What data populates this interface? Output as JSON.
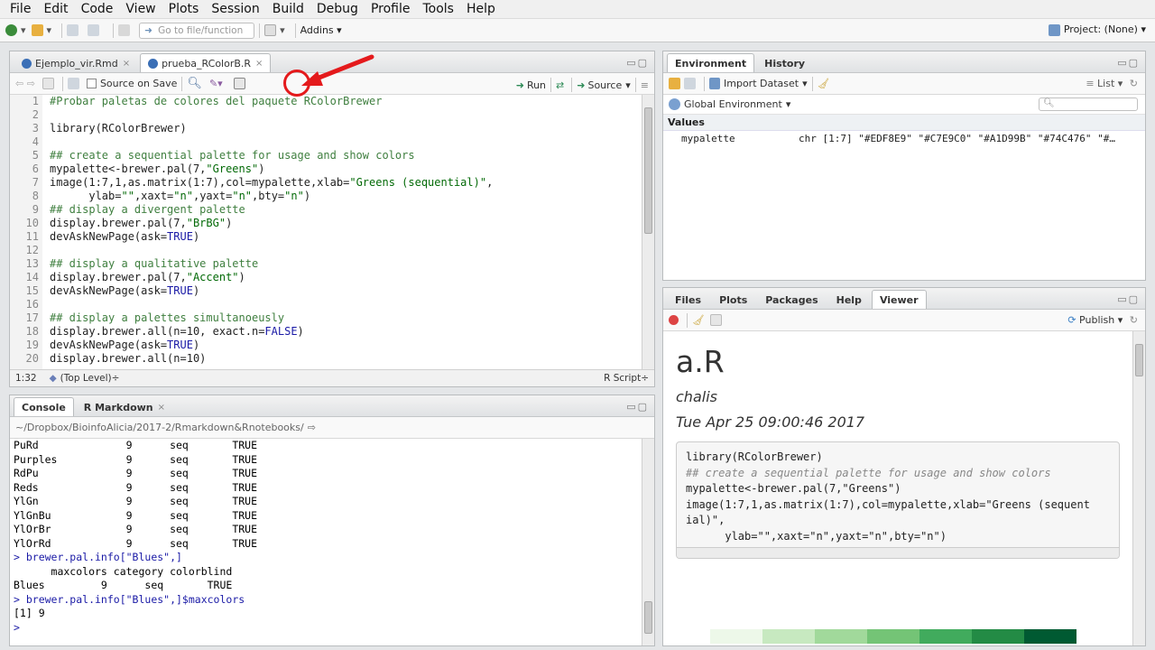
{
  "menu": [
    "File",
    "Edit",
    "Code",
    "View",
    "Plots",
    "Session",
    "Build",
    "Debug",
    "Profile",
    "Tools",
    "Help"
  ],
  "toolbar": {
    "goto_placeholder": "Go to file/function",
    "addins": "Addins",
    "project": "Project: (None)"
  },
  "editor": {
    "tabs": [
      {
        "label": "Ejemplo_vir.Rmd"
      },
      {
        "label": "prueba_RColorB.R"
      }
    ],
    "source_on_save": "Source on Save",
    "run": "Run",
    "source": "Source",
    "line_numbers": [
      "1",
      "2",
      "3",
      "4",
      "5",
      "6",
      "7",
      "8",
      "9",
      "10",
      "11",
      "12",
      "13",
      "14",
      "15",
      "16",
      "17",
      "18",
      "19",
      "20"
    ],
    "status": {
      "position": "1:32",
      "scope": "(Top Level)",
      "filetype": "R Script"
    }
  },
  "environment": {
    "tabs": [
      "Environment",
      "History"
    ],
    "import_dataset": "Import Dataset",
    "list_label": "List",
    "global_env": "Global Environment",
    "section": "Values",
    "var_name": "mypalette",
    "var_value": "chr [1:7] \"#EDF8E9\" \"#C7E9C0\" \"#A1D99B\" \"#74C476\" \"#…"
  },
  "console": {
    "tabs": [
      "Console",
      "R Markdown"
    ],
    "path": "~/Dropbox/BioinfoAlicia/2017-2/Rmarkdown&Rnotebooks/",
    "lines": [
      "PuRd              9      seq       TRUE",
      "Purples           9      seq       TRUE",
      "RdPu              9      seq       TRUE",
      "Reds              9      seq       TRUE",
      "YlGn              9      seq       TRUE",
      "YlGnBu            9      seq       TRUE",
      "YlOrBr            9      seq       TRUE",
      "YlOrRd            9      seq       TRUE",
      "> brewer.pal.info[\"Blues\",]",
      "      maxcolors category colorblind",
      "Blues         9      seq       TRUE",
      "> brewer.pal.info[\"Blues\",]$maxcolors",
      "[1] 9",
      "> "
    ]
  },
  "viewer": {
    "tabs": [
      "Files",
      "Plots",
      "Packages",
      "Help",
      "Viewer"
    ],
    "publish": "Publish",
    "title": "a.R",
    "author": "chalis",
    "date": "Tue Apr 25 09:00:46 2017",
    "code_lines": [
      "library(RColorBrewer)",
      "## create a sequential palette for usage and show colors",
      "mypalette<-brewer.pal(7,\"Greens\")",
      "image(1:7,1,as.matrix(1:7),col=mypalette,xlab=\"Greens (sequent",
      "ial)\",",
      "      ylab=\"\",xaxt=\"n\",yaxt=\"n\",bty=\"n\")"
    ],
    "palette": [
      "#EDF8E9",
      "#C7E9C0",
      "#A1D99B",
      "#74C476",
      "#41AB5D",
      "#238B45",
      "#005A32"
    ]
  },
  "colors": {
    "accent_red": "#e41a1c",
    "prompt_blue": "#1a1aa6"
  }
}
